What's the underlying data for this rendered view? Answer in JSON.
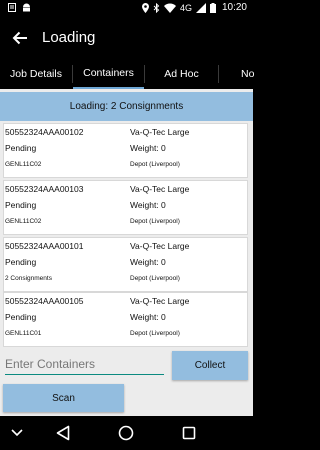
{
  "status_bar": {
    "time": "10:20",
    "network": "4G",
    "icons": [
      "tasks-icon",
      "android-icon",
      "location-icon",
      "bluetooth-icon",
      "wifi-icon",
      "signal-icon",
      "battery-icon"
    ]
  },
  "app_bar": {
    "title": "Loading"
  },
  "tabs": [
    {
      "label": "Job Details"
    },
    {
      "label": "Containers"
    },
    {
      "label": "Ad Hoc"
    },
    {
      "label": "No"
    }
  ],
  "banner": "Loading: 2 Consignments",
  "containers": [
    {
      "id": "50552324AAA00102",
      "type": "Va-Q-Tec Large",
      "status": "Pending",
      "weight": "Weight: 0",
      "code": "GENL11C02",
      "location": "Depot (Liverpool)"
    },
    {
      "id": "50552324AAA00103",
      "type": "Va-Q-Tec Large",
      "status": "Pending",
      "weight": "Weight: 0",
      "code": "GENL11C02",
      "location": "Depot (Liverpool)"
    },
    {
      "id": "50552324AAA00101",
      "type": "Va-Q-Tec Large",
      "status": "Pending",
      "weight": "Weight: 0",
      "code": "2 Consignments",
      "location": "Depot (Liverpool)"
    },
    {
      "id": "50552324AAA00105",
      "type": "Va-Q-Tec Large",
      "status": "Pending",
      "weight": "Weight: 0",
      "code": "GENL11C01",
      "location": "Depot (Liverpool)"
    }
  ],
  "input": {
    "placeholder": "Enter Containers",
    "value": ""
  },
  "buttons": {
    "collect": "Collect",
    "scan": "Scan"
  },
  "colors": {
    "accent": "#93bddf",
    "underline": "#0b8a80",
    "tab_indicator": "#6fa8d6"
  }
}
